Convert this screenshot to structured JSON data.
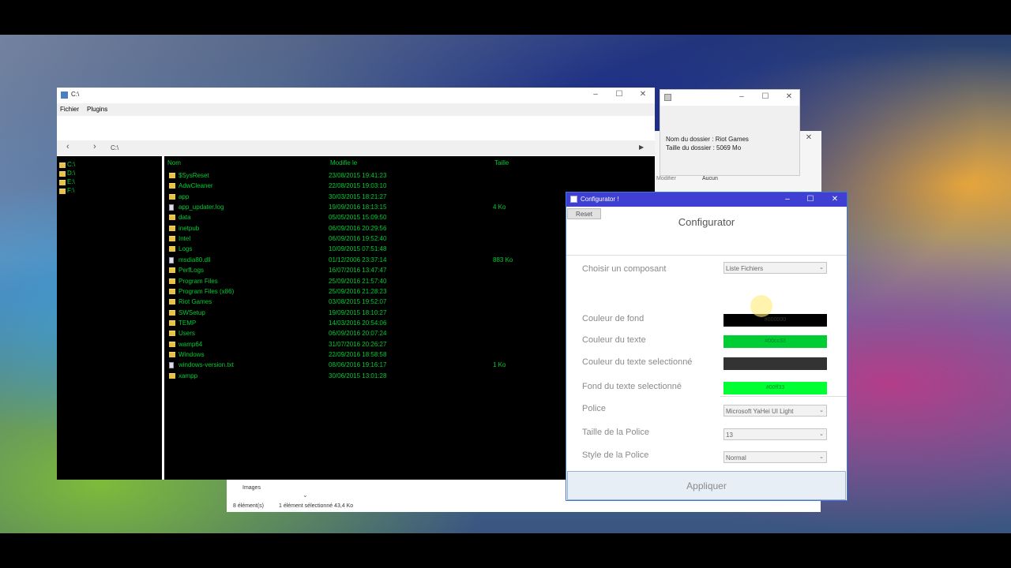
{
  "explorer": {
    "title": "C:\\",
    "menu": [
      "Fichier",
      "Plugins"
    ],
    "address": "C:\\",
    "drives": [
      "C:\\",
      "D:\\",
      "E:\\",
      "F:\\"
    ],
    "columns": {
      "name": "Nom",
      "modified": "Modifie le",
      "size": "Taille"
    },
    "rows": [
      {
        "name": "$SysReset",
        "date": "23/08/2015 19:41:23",
        "size": "",
        "type": "folder"
      },
      {
        "name": "AdwCleaner",
        "date": "22/08/2015 19:03:10",
        "size": "",
        "type": "folder"
      },
      {
        "name": "app",
        "date": "30/03/2015 18:21:27",
        "size": "",
        "type": "folder"
      },
      {
        "name": "app_updater.log",
        "date": "19/09/2016 18:13:15",
        "size": "4 Ko",
        "type": "file"
      },
      {
        "name": "data",
        "date": "05/05/2015 15:09:50",
        "size": "",
        "type": "folder"
      },
      {
        "name": "inetpub",
        "date": "06/09/2016 20:29:56",
        "size": "",
        "type": "folder"
      },
      {
        "name": "Intel",
        "date": "06/09/2016 19:52:40",
        "size": "",
        "type": "folder"
      },
      {
        "name": "Logs",
        "date": "10/09/2015 07:51:48",
        "size": "",
        "type": "folder"
      },
      {
        "name": "msdia80.dll",
        "date": "01/12/2006 23:37:14",
        "size": "883 Ko",
        "type": "file"
      },
      {
        "name": "PerfLogs",
        "date": "16/07/2016 13:47:47",
        "size": "",
        "type": "folder"
      },
      {
        "name": "Program Files",
        "date": "25/09/2016 21:57:40",
        "size": "",
        "type": "folder"
      },
      {
        "name": "Program Files (x86)",
        "date": "25/09/2016 21:28:23",
        "size": "",
        "type": "folder"
      },
      {
        "name": "Riot Games",
        "date": "03/08/2015 19:52:07",
        "size": "",
        "type": "folder"
      },
      {
        "name": "SWSetup",
        "date": "19/09/2015 18:10:27",
        "size": "",
        "type": "folder"
      },
      {
        "name": "TEMP",
        "date": "14/03/2016 20:54:06",
        "size": "",
        "type": "folder"
      },
      {
        "name": "Users",
        "date": "06/09/2016 20:07:24",
        "size": "",
        "type": "folder"
      },
      {
        "name": "wamp64",
        "date": "31/07/2016 20:26:27",
        "size": "",
        "type": "folder"
      },
      {
        "name": "Windows",
        "date": "22/09/2016 18:58:58",
        "size": "",
        "type": "folder"
      },
      {
        "name": "windows-version.txt",
        "date": "08/06/2016 19:16:17",
        "size": "1 Ko",
        "type": "file"
      },
      {
        "name": "xampp",
        "date": "30/06/2015 13:01:28",
        "size": "",
        "type": "folder"
      }
    ]
  },
  "info_dialog": {
    "line1": "Nom du dossier : Riot Games",
    "line2": "Taille du dossier : 5069 Mo"
  },
  "background_window": {
    "modifier": "Modifier",
    "aucun": "Aucun",
    "items_count": "8 élément(s)",
    "selected": "1 élément sélectionné  43,4 Ko",
    "images": "Images"
  },
  "configurator": {
    "window_title": "Configurator !",
    "reset": "Reset",
    "heading": "Configurator",
    "component_label": "Choisir un composant",
    "component_value": "Liste Fichiers",
    "bg_label": "Couleur de fond",
    "bg_value": "#000000",
    "bg_color": "#000000",
    "text_label": "Couleur du texte",
    "text_value": "#00cc33",
    "text_color": "#00cc33",
    "seltext_label": "Couleur du texte selectionné",
    "seltext_value": "",
    "seltext_color": "#333333",
    "selbg_label": "Fond du texte selectionné",
    "selbg_value": "#00ff33",
    "selbg_color": "#00ff33",
    "font_label": "Police",
    "font_value": "Microsoft YaHei UI Light",
    "size_label": "Taille de la Police",
    "size_value": "13",
    "style_label": "Style de la Police",
    "style_value": "Normal",
    "apply": "Appliquer"
  }
}
